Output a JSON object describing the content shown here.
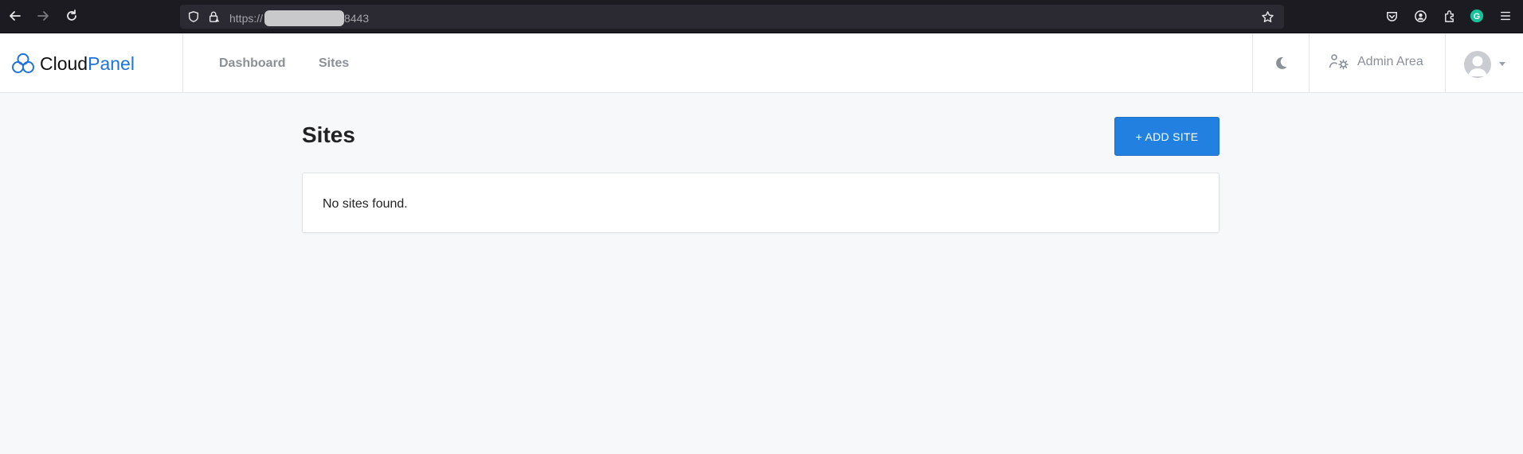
{
  "browser": {
    "url_prefix": "https://",
    "url_suffix": "8443"
  },
  "header": {
    "brand_part1": "Cloud",
    "brand_part2": "Panel",
    "nav": [
      {
        "label": "Dashboard"
      },
      {
        "label": "Sites"
      }
    ],
    "admin_label": "Admin Area"
  },
  "main": {
    "title": "Sites",
    "add_button_label": "+ ADD SITE",
    "empty_message": "No sites found."
  },
  "colors": {
    "accent": "#1e73d8",
    "button": "#2180e0",
    "background": "#f7f8fa"
  }
}
